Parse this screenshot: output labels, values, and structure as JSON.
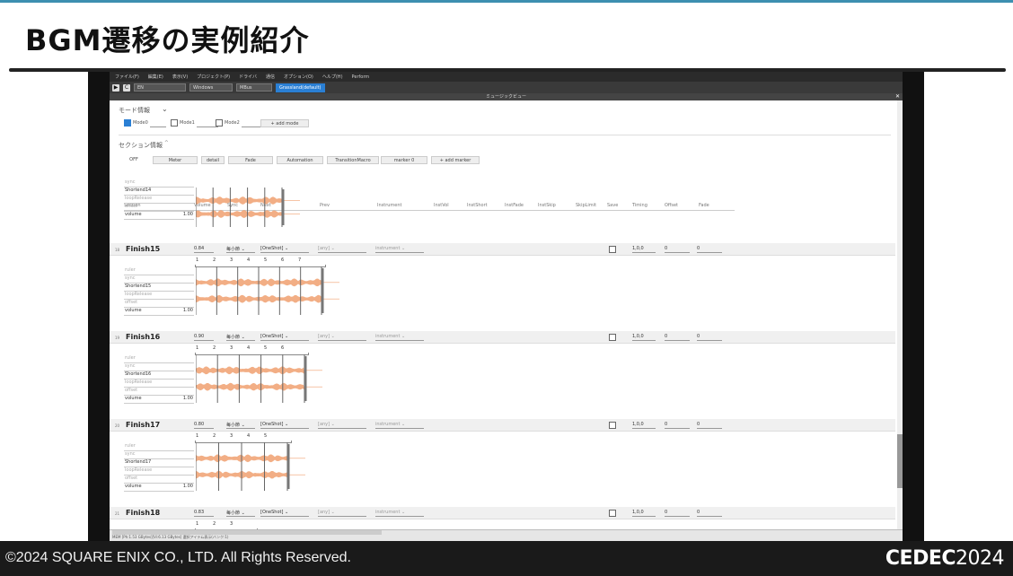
{
  "slide": {
    "title": "BGM遷移の実例紹介",
    "copyright": "©2024 SQUARE ENIX CO., LTD. All Rights Reserved.",
    "event_logo_a": "CEDEC",
    "event_logo_b": "2024"
  },
  "app": {
    "menu": [
      "ファイル(F)",
      "編集(E)",
      "表示(V)",
      "プロジェクト(P)",
      "ドライバ",
      "通信",
      "オプション(O)",
      "ヘルプ(H)",
      "Perform"
    ],
    "toolbar": {
      "lang": "EN",
      "platform": "Windows",
      "device": "MBus",
      "tab": "Grassland(default)"
    },
    "panel_title": "ミュージックビュー",
    "mode_section_label": "モード情報",
    "modes": [
      {
        "label": "Mode0",
        "checked": true
      },
      {
        "label": "Mode1",
        "checked": false
      },
      {
        "label": "Mode2",
        "checked": false
      }
    ],
    "add_mode": "+ add mode",
    "section_info_label": "セクション情報",
    "section_toolbar": [
      "OFF",
      "Meter",
      "detail",
      "Fade",
      "Automation",
      "TransitionMacro",
      "marker 0",
      "+ add marker"
    ],
    "headers": [
      "Section",
      "Volume",
      "Sync",
      "Next",
      "Prev",
      "Instrument",
      "InstVol",
      "InstShort",
      "InstFade",
      "InstSkip",
      "SkipLimit",
      "Save",
      "Timing",
      "Offset",
      "Fade"
    ],
    "prop_labels": {
      "ruler": "ruler",
      "sync": "sync",
      "loop": "loopRelease",
      "offset": "offset",
      "volume": "volume",
      "vol_value": "1.00"
    },
    "top_section": {
      "name": "Shortend14"
    },
    "sections": [
      {
        "num": "18",
        "name": "Finish15",
        "volume": "0.84",
        "sync": "每小節",
        "next": "[OneShot]",
        "prev": "[any]",
        "instrument": "instrument",
        "timing": "1,0,0",
        "offset": "0",
        "fade": "0",
        "short": "Shortend15",
        "ruler": [
          "1",
          "2",
          "3",
          "4",
          "5",
          "6",
          "7"
        ]
      },
      {
        "num": "19",
        "name": "Finish16",
        "volume": "0.90",
        "sync": "每小節",
        "next": "[OneShot]",
        "prev": "[any]",
        "instrument": "instrument",
        "timing": "1,0,0",
        "offset": "0",
        "fade": "0",
        "short": "Shortend16",
        "ruler": [
          "1",
          "2",
          "3",
          "4",
          "5",
          "6"
        ]
      },
      {
        "num": "20",
        "name": "Finish17",
        "volume": "0.80",
        "sync": "每小節",
        "next": "[OneShot]",
        "prev": "[any]",
        "instrument": "instrument",
        "timing": "1,0,0",
        "offset": "0",
        "fade": "0",
        "short": "Shortend17",
        "ruler": [
          "1",
          "2",
          "3",
          "4",
          "5"
        ]
      },
      {
        "num": "21",
        "name": "Finish18",
        "volume": "0.83",
        "sync": "每小節",
        "next": "[OneShot]",
        "prev": "[any]",
        "instrument": "instrument",
        "timing": "1,0,0",
        "offset": "0",
        "fade": "0",
        "short": "",
        "ruler": [
          "1",
          "2",
          "3"
        ]
      }
    ],
    "status": "MEM [Ph:1.53 GBytes][Vi:6.13 GBytes] 選択アイテム表示(バンク:1)",
    "colors": {
      "accent": "#2a7fd4",
      "wave": "#f0a070"
    }
  }
}
